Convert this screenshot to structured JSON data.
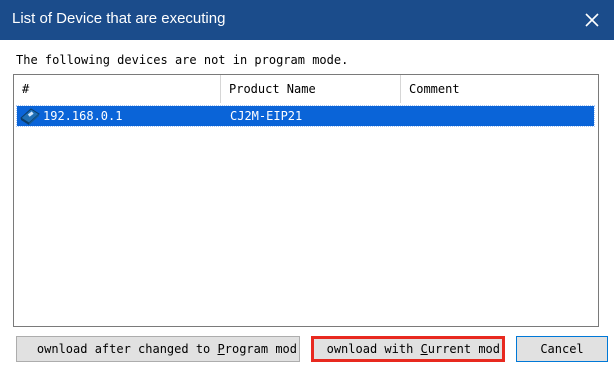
{
  "window": {
    "title": "List of Device that are executing",
    "close_icon": "close-icon"
  },
  "message": "The following devices are not in program mode.",
  "list": {
    "columns": [
      "#",
      "Product Name",
      "Comment"
    ],
    "rows": [
      {
        "address": "192.168.0.1",
        "product_name": "CJ2M-EIP21",
        "comment": "",
        "icon": "plc-device-icon",
        "selected": true
      }
    ]
  },
  "buttons": {
    "download_after_change": {
      "pre": "ownload after changed to ",
      "mnemonic": "P",
      "post": "rogram mod"
    },
    "download_current": {
      "pre": "ownload with ",
      "mnemonic": "C",
      "post": "urrent mod",
      "highlight_color": "#e8291f"
    },
    "cancel": "Cancel"
  },
  "colors": {
    "titlebar": "#1b4c8b",
    "selection": "#0a64d8"
  }
}
